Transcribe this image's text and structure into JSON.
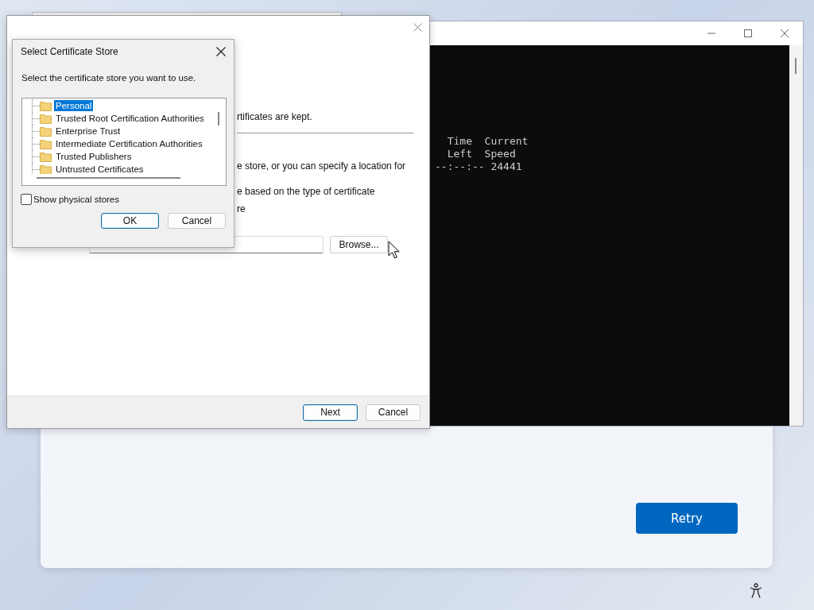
{
  "setup_screen": {
    "button": "Retry"
  },
  "console": {
    "lines": [
      "  Time  Current",
      "  Left  Speed",
      "--:--:-- 24441"
    ]
  },
  "wizard": {
    "body_fragments": [
      "rtificates are kept.",
      "e store, or you can specify a location for",
      "e based on the type of certificate",
      "re"
    ],
    "browse_button": "Browse...",
    "buttons": [
      {
        "label": "Next",
        "default": true
      },
      {
        "label": "Cancel",
        "default": false
      }
    ]
  },
  "store_dialog": {
    "title": "Select Certificate Store",
    "prompt": "Select the certificate store you want to use.",
    "stores": [
      {
        "label": "Personal",
        "selected": true
      },
      {
        "label": "Trusted Root Certification Authorities",
        "selected": false
      },
      {
        "label": "Enterprise Trust",
        "selected": false
      },
      {
        "label": "Intermediate Certification Authorities",
        "selected": false
      },
      {
        "label": "Trusted Publishers",
        "selected": false
      },
      {
        "label": "Untrusted Certificates",
        "selected": false
      }
    ],
    "show_physical_stores": {
      "label": "Show physical stores",
      "checked": false
    },
    "buttons": [
      {
        "label": "OK",
        "default": true
      },
      {
        "label": "Cancel",
        "default": false
      }
    ]
  }
}
